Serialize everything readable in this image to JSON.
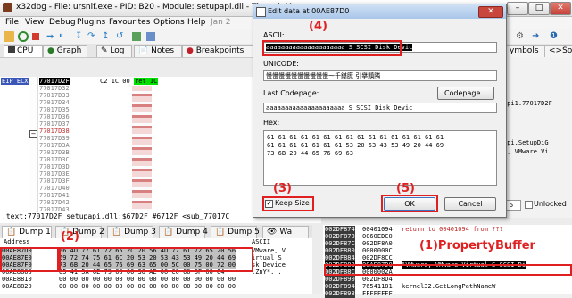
{
  "colors": {
    "annotation": "#e02020",
    "dialog_title": "#a9c6e8",
    "selection": "#000000"
  },
  "window": {
    "title": "x32dbg - File: ursnif.exe - PID: B20 - Module: setupapi.dll - Thread: M",
    "menu": [
      "File",
      "View",
      "Debug",
      "Plugins",
      "Favourites",
      "Options",
      "Help",
      "Jan 2"
    ]
  },
  "tabs": [
    "CPU",
    "Graph",
    "Log",
    "Notes",
    "Breakpoints",
    "ymbols",
    "<>So"
  ],
  "eip_label": "EIP ECX",
  "disasm": {
    "rows": [
      "77017D2F",
      "77017D32",
      "77017D33",
      "77017D34",
      "77017D35",
      "77017D36",
      "77017D37",
      "77017D38",
      "77017D39",
      "77017D3A",
      "77017D3B",
      "77017D3C",
      "77017D3D",
      "77017D3E",
      "77017D3F",
      "77017D40",
      "77017D41",
      "77017D42",
      "77017D43"
    ],
    "first_bytes": "C2 1C 00",
    "first_instr": "ret 1C"
  },
  "right_panel": {
    "lines": [
      "api1.77017D2F",
      "api.SetupDiG",
      "e, VMware Vi"
    ],
    "spin": "5",
    "unlocked": "Unlocked"
  },
  "status_line": ".text:77017D2F setupapi.dll:$67D2F #6712F <sub_77017C",
  "dump": {
    "tabs": [
      "Dump 1",
      "Dump 2",
      "Dump 3",
      "Dump 4",
      "Dump 5",
      "Wa"
    ],
    "headers": [
      "Address",
      "Hex",
      "ASCII"
    ],
    "rows": [
      {
        "addr": "00AE87D0",
        "hex": "56 4D 77 61 72 65 2C 20 56 4D 77 61 72 65 20 56",
        "ascii": "VMware, V"
      },
      {
        "addr": "00AE87E0",
        "hex": "69 72 74 75 61 6C 20 53 20 53 43 53 49 20 44 69",
        "ascii": "irtual S"
      },
      {
        "addr": "00AE87F0",
        "hex": "73 6B 20 44 65 76 69 63 65 00 5C 00 75 00 72 00",
        "ascii": "sk Device"
      },
      {
        "addr": "00AE8800",
        "hex": "05 41 5A 6E 79 00 00 30 AE 00 C0 00 6F 00 64",
        "ascii": ".ZnY*. ."
      },
      {
        "addr": "00AE8810",
        "hex": "00 00 00 00 00 00 00 00 00 00 00 00 00 00 00 00",
        "ascii": ""
      },
      {
        "addr": "00AE8820",
        "hex": "00 00 00 00 00 00 00 00 00 00 00 00 00 00 00 00",
        "ascii": ""
      }
    ]
  },
  "stack": {
    "rows": [
      {
        "addr": "002DF874",
        "val": "00401094",
        "cmt": "return to 00401094 from ???"
      },
      {
        "addr": "002DF878",
        "val": "0060EDC0",
        "cmt": ""
      },
      {
        "addr": "002DF87C",
        "val": "002DF8A0",
        "cmt": ""
      },
      {
        "addr": "002DF880",
        "val": "0000000C",
        "cmt": ""
      },
      {
        "addr": "002DF884",
        "val": "002DF8CC",
        "cmt": ""
      },
      {
        "addr": "002DF888",
        "val": "00AE87D0",
        "cmt": "\"VMware, VMware Virtual S SCSI Di"
      },
      {
        "addr": "002DF88C",
        "val": "0000002A",
        "cmt": ""
      },
      {
        "addr": "002DF890",
        "val": "002DF8D4",
        "cmt": ""
      },
      {
        "addr": "002DF894",
        "val": "76541181",
        "cmt": "kernel32.GetLongPathNameW"
      },
      {
        "addr": "002DF898",
        "val": "FFFFFFFF",
        "cmt": ""
      }
    ]
  },
  "dialog": {
    "title": "Edit data at 00AE87D0",
    "ascii_label": "ASCII:",
    "ascii_value": "aaaaaaaaaaaaaaaaaaaaa S SCSI Disk Devic",
    "unicode_label": "UNICODE:",
    "unicode_value": "慢慢慢慢慢慢慢慢慢慢⁓千䥓䐠 引擧黰隣",
    "codepage_label": "Last Codepage:",
    "codepage_button": "Codepage...",
    "codepage_value": "aaaaaaaaaaaaaaaaaaaaa S SCSI Disk Devic",
    "hex_label": "Hex:",
    "hex_rows": [
      "61 61 61 61 61 61 61 61 61 61 61 61 61 61 61 61",
      "61 61 61 61 61 61 61 53 20 53 43 53 49 20 44 69",
      "73 6B 20 44 65 76 69 63"
    ],
    "keep_size": "Keep Size",
    "ok": "OK",
    "cancel": "Cancel"
  },
  "annotations": {
    "n2": "(2)",
    "n3": "(3)",
    "n4": "(4)",
    "n5": "(5)",
    "n1": "(1)PropertyBuffer"
  }
}
